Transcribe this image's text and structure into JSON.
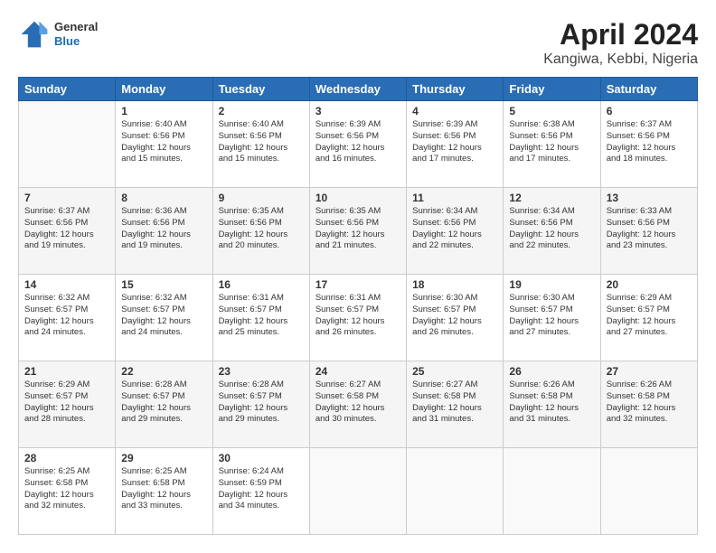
{
  "header": {
    "logo": {
      "general": "General",
      "blue": "Blue"
    },
    "title": "April 2024",
    "subtitle": "Kangiwa, Kebbi, Nigeria"
  },
  "weekdays": [
    "Sunday",
    "Monday",
    "Tuesday",
    "Wednesday",
    "Thursday",
    "Friday",
    "Saturday"
  ],
  "weeks": [
    [
      {
        "day": "",
        "sunrise": "",
        "sunset": "",
        "daylight": ""
      },
      {
        "day": "1",
        "sunrise": "Sunrise: 6:40 AM",
        "sunset": "Sunset: 6:56 PM",
        "daylight": "Daylight: 12 hours and 15 minutes."
      },
      {
        "day": "2",
        "sunrise": "Sunrise: 6:40 AM",
        "sunset": "Sunset: 6:56 PM",
        "daylight": "Daylight: 12 hours and 15 minutes."
      },
      {
        "day": "3",
        "sunrise": "Sunrise: 6:39 AM",
        "sunset": "Sunset: 6:56 PM",
        "daylight": "Daylight: 12 hours and 16 minutes."
      },
      {
        "day": "4",
        "sunrise": "Sunrise: 6:39 AM",
        "sunset": "Sunset: 6:56 PM",
        "daylight": "Daylight: 12 hours and 17 minutes."
      },
      {
        "day": "5",
        "sunrise": "Sunrise: 6:38 AM",
        "sunset": "Sunset: 6:56 PM",
        "daylight": "Daylight: 12 hours and 17 minutes."
      },
      {
        "day": "6",
        "sunrise": "Sunrise: 6:37 AM",
        "sunset": "Sunset: 6:56 PM",
        "daylight": "Daylight: 12 hours and 18 minutes."
      }
    ],
    [
      {
        "day": "7",
        "sunrise": "Sunrise: 6:37 AM",
        "sunset": "Sunset: 6:56 PM",
        "daylight": "Daylight: 12 hours and 19 minutes."
      },
      {
        "day": "8",
        "sunrise": "Sunrise: 6:36 AM",
        "sunset": "Sunset: 6:56 PM",
        "daylight": "Daylight: 12 hours and 19 minutes."
      },
      {
        "day": "9",
        "sunrise": "Sunrise: 6:35 AM",
        "sunset": "Sunset: 6:56 PM",
        "daylight": "Daylight: 12 hours and 20 minutes."
      },
      {
        "day": "10",
        "sunrise": "Sunrise: 6:35 AM",
        "sunset": "Sunset: 6:56 PM",
        "daylight": "Daylight: 12 hours and 21 minutes."
      },
      {
        "day": "11",
        "sunrise": "Sunrise: 6:34 AM",
        "sunset": "Sunset: 6:56 PM",
        "daylight": "Daylight: 12 hours and 22 minutes."
      },
      {
        "day": "12",
        "sunrise": "Sunrise: 6:34 AM",
        "sunset": "Sunset: 6:56 PM",
        "daylight": "Daylight: 12 hours and 22 minutes."
      },
      {
        "day": "13",
        "sunrise": "Sunrise: 6:33 AM",
        "sunset": "Sunset: 6:56 PM",
        "daylight": "Daylight: 12 hours and 23 minutes."
      }
    ],
    [
      {
        "day": "14",
        "sunrise": "Sunrise: 6:32 AM",
        "sunset": "Sunset: 6:57 PM",
        "daylight": "Daylight: 12 hours and 24 minutes."
      },
      {
        "day": "15",
        "sunrise": "Sunrise: 6:32 AM",
        "sunset": "Sunset: 6:57 PM",
        "daylight": "Daylight: 12 hours and 24 minutes."
      },
      {
        "day": "16",
        "sunrise": "Sunrise: 6:31 AM",
        "sunset": "Sunset: 6:57 PM",
        "daylight": "Daylight: 12 hours and 25 minutes."
      },
      {
        "day": "17",
        "sunrise": "Sunrise: 6:31 AM",
        "sunset": "Sunset: 6:57 PM",
        "daylight": "Daylight: 12 hours and 26 minutes."
      },
      {
        "day": "18",
        "sunrise": "Sunrise: 6:30 AM",
        "sunset": "Sunset: 6:57 PM",
        "daylight": "Daylight: 12 hours and 26 minutes."
      },
      {
        "day": "19",
        "sunrise": "Sunrise: 6:30 AM",
        "sunset": "Sunset: 6:57 PM",
        "daylight": "Daylight: 12 hours and 27 minutes."
      },
      {
        "day": "20",
        "sunrise": "Sunrise: 6:29 AM",
        "sunset": "Sunset: 6:57 PM",
        "daylight": "Daylight: 12 hours and 27 minutes."
      }
    ],
    [
      {
        "day": "21",
        "sunrise": "Sunrise: 6:29 AM",
        "sunset": "Sunset: 6:57 PM",
        "daylight": "Daylight: 12 hours and 28 minutes."
      },
      {
        "day": "22",
        "sunrise": "Sunrise: 6:28 AM",
        "sunset": "Sunset: 6:57 PM",
        "daylight": "Daylight: 12 hours and 29 minutes."
      },
      {
        "day": "23",
        "sunrise": "Sunrise: 6:28 AM",
        "sunset": "Sunset: 6:57 PM",
        "daylight": "Daylight: 12 hours and 29 minutes."
      },
      {
        "day": "24",
        "sunrise": "Sunrise: 6:27 AM",
        "sunset": "Sunset: 6:58 PM",
        "daylight": "Daylight: 12 hours and 30 minutes."
      },
      {
        "day": "25",
        "sunrise": "Sunrise: 6:27 AM",
        "sunset": "Sunset: 6:58 PM",
        "daylight": "Daylight: 12 hours and 31 minutes."
      },
      {
        "day": "26",
        "sunrise": "Sunrise: 6:26 AM",
        "sunset": "Sunset: 6:58 PM",
        "daylight": "Daylight: 12 hours and 31 minutes."
      },
      {
        "day": "27",
        "sunrise": "Sunrise: 6:26 AM",
        "sunset": "Sunset: 6:58 PM",
        "daylight": "Daylight: 12 hours and 32 minutes."
      }
    ],
    [
      {
        "day": "28",
        "sunrise": "Sunrise: 6:25 AM",
        "sunset": "Sunset: 6:58 PM",
        "daylight": "Daylight: 12 hours and 32 minutes."
      },
      {
        "day": "29",
        "sunrise": "Sunrise: 6:25 AM",
        "sunset": "Sunset: 6:58 PM",
        "daylight": "Daylight: 12 hours and 33 minutes."
      },
      {
        "day": "30",
        "sunrise": "Sunrise: 6:24 AM",
        "sunset": "Sunset: 6:59 PM",
        "daylight": "Daylight: 12 hours and 34 minutes."
      },
      {
        "day": "",
        "sunrise": "",
        "sunset": "",
        "daylight": ""
      },
      {
        "day": "",
        "sunrise": "",
        "sunset": "",
        "daylight": ""
      },
      {
        "day": "",
        "sunrise": "",
        "sunset": "",
        "daylight": ""
      },
      {
        "day": "",
        "sunrise": "",
        "sunset": "",
        "daylight": ""
      }
    ]
  ]
}
